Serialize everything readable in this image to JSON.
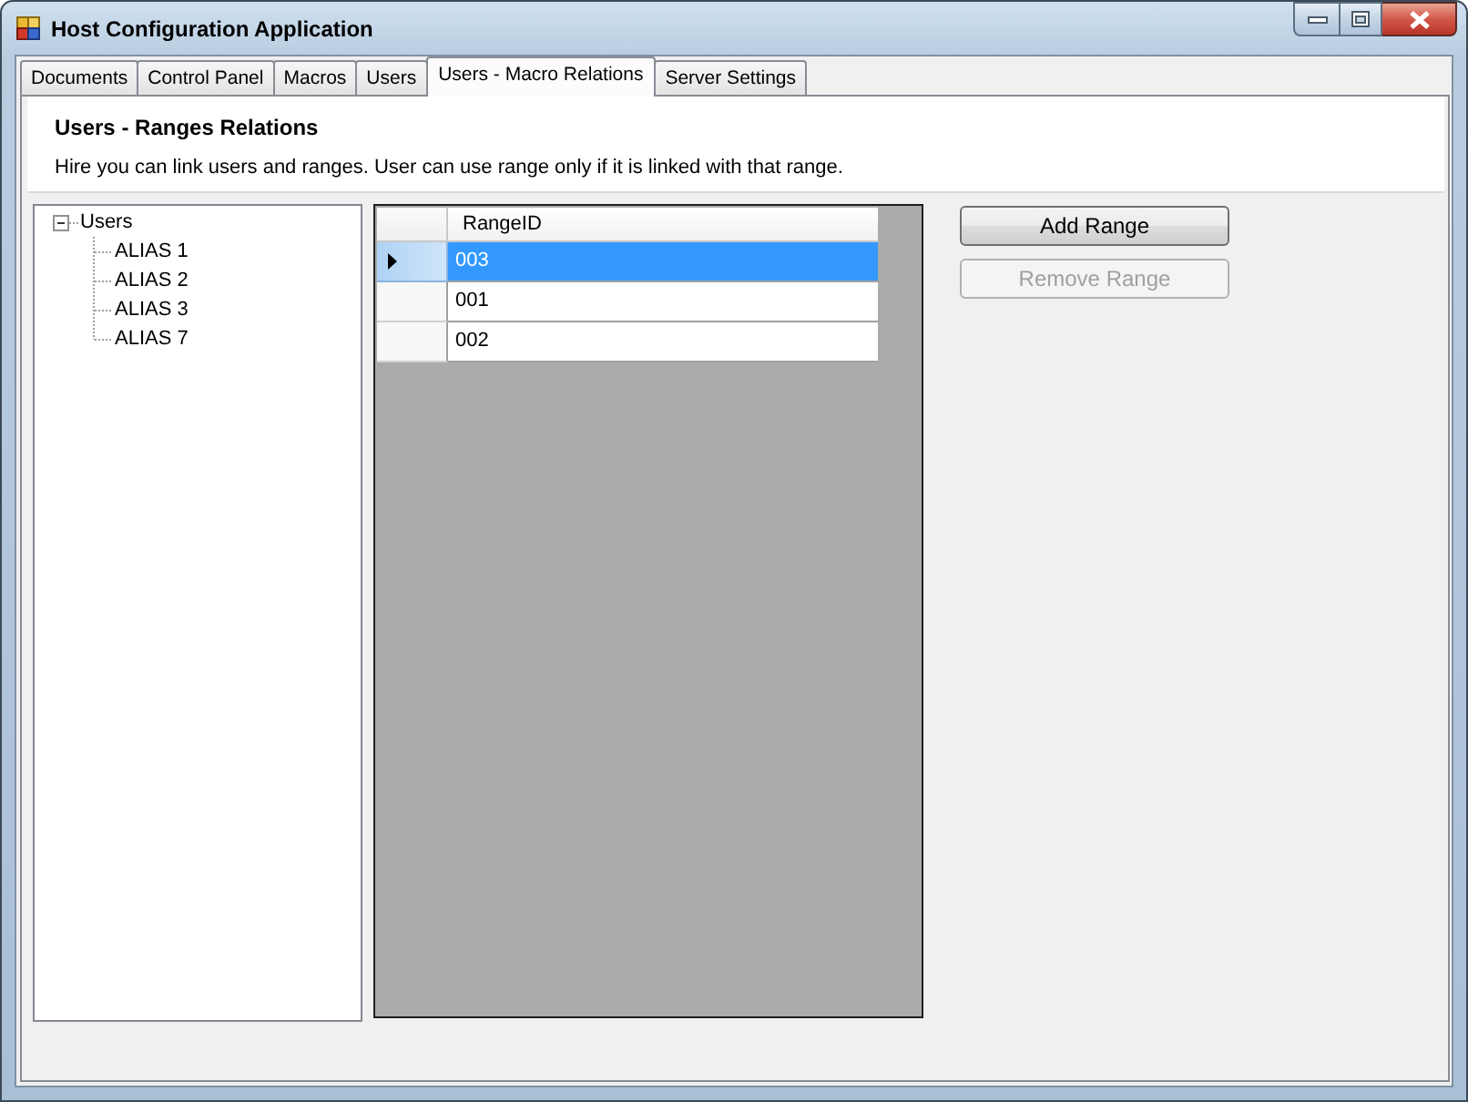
{
  "window": {
    "title": "Host Configuration Application"
  },
  "tabs": [
    {
      "label": "Documents",
      "selected": false
    },
    {
      "label": "Control Panel",
      "selected": false
    },
    {
      "label": "Macros",
      "selected": false
    },
    {
      "label": "Users",
      "selected": false
    },
    {
      "label": "Users - Macro Relations",
      "selected": true
    },
    {
      "label": "Server Settings",
      "selected": false
    }
  ],
  "panel": {
    "title": "Users - Ranges Relations",
    "description": "Hire you can link users and ranges. User can use range only if it is linked with that range."
  },
  "tree": {
    "items": [
      {
        "label": "Users",
        "expanded": true,
        "children": [
          {
            "label": "ALIAS 1"
          },
          {
            "label": "ALIAS 2"
          },
          {
            "label": "ALIAS 3"
          },
          {
            "label": "ALIAS 7"
          }
        ]
      }
    ]
  },
  "grid": {
    "columns": [
      "RangeID"
    ],
    "rows": [
      {
        "cells": [
          "003"
        ],
        "selected": true
      },
      {
        "cells": [
          "001"
        ],
        "selected": false
      },
      {
        "cells": [
          "002"
        ],
        "selected": false
      }
    ]
  },
  "buttons": [
    {
      "label": "Add Range",
      "disabled": false
    },
    {
      "label": "Remove Range",
      "disabled": true
    }
  ]
}
